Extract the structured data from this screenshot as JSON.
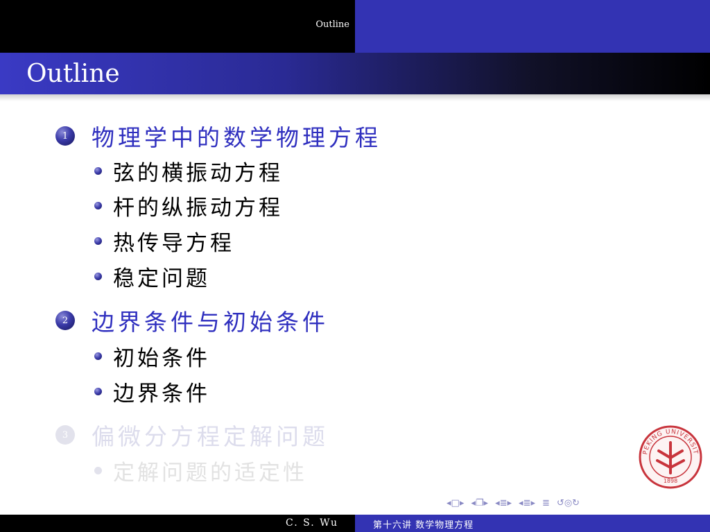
{
  "header": {
    "section_title": "Outline"
  },
  "frame": {
    "title": "Outline"
  },
  "outline": {
    "sections": [
      {
        "number": "1",
        "label": "物理学中的数学物理方程",
        "state": "active",
        "subsections": [
          "弦的横振动方程",
          "杆的纵振动方程",
          "热传导方程",
          "稳定问题"
        ]
      },
      {
        "number": "2",
        "label": "边界条件与初始条件",
        "state": "active",
        "subsections": [
          "初始条件",
          "边界条件"
        ]
      },
      {
        "number": "3",
        "label": "偏微分方程定解问题",
        "state": "dimmed",
        "subsections": [
          "定解问题的适定性"
        ]
      }
    ]
  },
  "footer": {
    "author": "C. S. Wu",
    "lecture_title": "第十六讲 数学物理方程"
  },
  "seal": {
    "text": "PEKING UNIVERSITY",
    "year": "1898"
  },
  "nav_icons": [
    "frame-prev-icon",
    "frame-icon",
    "frame-next-icon",
    "subsection-prev-icon",
    "subsection-icon",
    "subsection-next-icon",
    "section-prev-icon",
    "section-icon",
    "section-next-icon",
    "subsubsection-prev-icon",
    "subsubsection-icon",
    "subsubsection-next-icon",
    "toc-icon",
    "search-icon"
  ],
  "colors": {
    "header_left": "#000000",
    "header_right": "#3333b3",
    "section_active": "#2f2fbf",
    "section_dim": "#dcdcec",
    "seal": "#c8343c"
  }
}
